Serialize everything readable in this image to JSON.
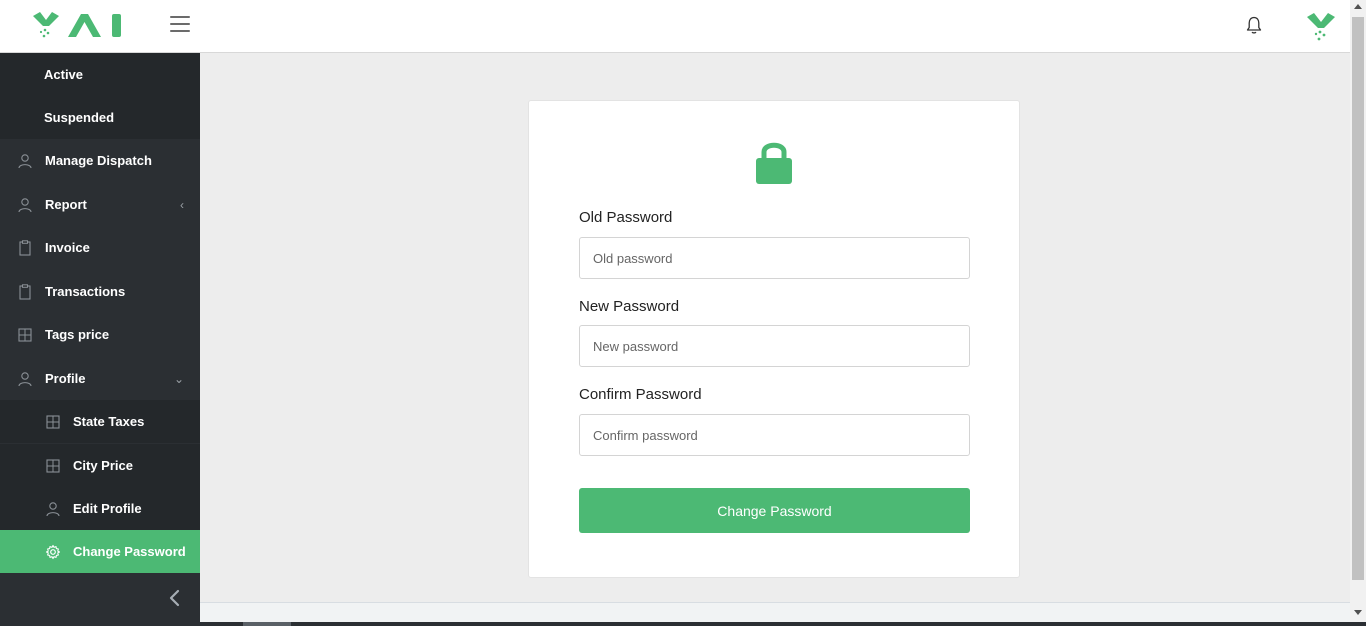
{
  "header": {
    "logo_name": "logo",
    "menu_icon": "hamburger-icon",
    "notification_icon": "bell-icon",
    "avatar_icon": "avatar-logo"
  },
  "sidebar": {
    "items": [
      {
        "label": "Active",
        "icon": "",
        "kind": "sub-plain"
      },
      {
        "label": "Suspended",
        "icon": "",
        "kind": "sub-plain"
      },
      {
        "label": "Manage Dispatch",
        "icon": "user-icon",
        "kind": "top"
      },
      {
        "label": "Report",
        "icon": "user-icon",
        "kind": "top",
        "arrow": "‹"
      },
      {
        "label": "Invoice",
        "icon": "document-icon",
        "kind": "top"
      },
      {
        "label": "Transactions",
        "icon": "document-icon",
        "kind": "top"
      },
      {
        "label": "Tags price",
        "icon": "calculator-icon",
        "kind": "top"
      },
      {
        "label": "Profile",
        "icon": "user-icon",
        "kind": "top",
        "arrow": "⌄"
      },
      {
        "label": "State Taxes",
        "icon": "calculator-icon",
        "kind": "child"
      },
      {
        "label": "City Price",
        "icon": "calculator-icon",
        "kind": "child"
      },
      {
        "label": "Edit Profile",
        "icon": "user-icon",
        "kind": "child"
      },
      {
        "label": "Change Password",
        "icon": "gear-icon",
        "kind": "child",
        "active": true
      }
    ],
    "collapse_icon": "chevron-left-icon"
  },
  "form": {
    "lock_icon": "lock-icon",
    "old_password": {
      "label": "Old Password",
      "placeholder": "Old password"
    },
    "new_password": {
      "label": "New Password",
      "placeholder": "New password"
    },
    "confirm_password": {
      "label": "Confirm Password",
      "placeholder": "Confirm password"
    },
    "submit_label": "Change Password"
  },
  "colors": {
    "accent": "#4cb974",
    "sidebar_bg": "#2b2f33",
    "sidebar_sub_bg": "#24282b",
    "page_bg": "#ededed"
  }
}
